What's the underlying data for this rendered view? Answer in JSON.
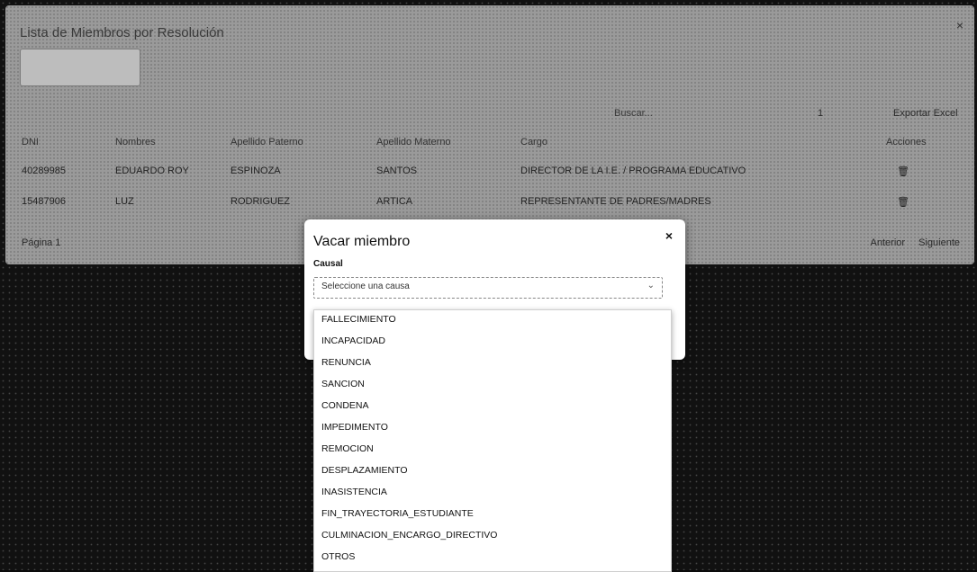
{
  "panel": {
    "title": "Lista de Miembros por Resolución",
    "close_glyph": "×",
    "search_label": "Buscar...",
    "search_count": "1",
    "export_label": "Exportar Excel",
    "columns": [
      "DNI",
      "Nombres",
      "Apellido Paterno",
      "Apellido Materno",
      "Cargo",
      "Acciones"
    ],
    "rows": [
      [
        "40289985",
        "EDUARDO ROY",
        "ESPINOZA",
        "SANTOS",
        "DIRECTOR DE LA I.E. / PROGRAMA EDUCATIVO",
        "🗑"
      ],
      [
        "15487906",
        "LUZ",
        "RODRIGUEZ",
        "ARTICA",
        "REPRESENTANTE DE PADRES/MADRES",
        "🗑"
      ]
    ],
    "pager_left": "Página 1",
    "pager_prev": "Anterior",
    "pager_next": "Siguiente"
  },
  "modal": {
    "title": "Vacar miembro",
    "close_glyph": "×",
    "field_label": "Causal",
    "select_placeholder": "Seleccione una causa",
    "select_arrow": "⌄"
  },
  "dropdown": {
    "options": [
      "FALLECIMIENTO",
      "INCAPACIDAD",
      "RENUNCIA",
      "SANCION",
      "CONDENA",
      "IMPEDIMENTO",
      "REMOCION",
      "DESPLAZAMIENTO",
      "INASISTENCIA",
      "FIN_TRAYECTORIA_ESTUDIANTE",
      "CULMINACION_ENCARGO_DIRECTIVO",
      "OTROS"
    ]
  }
}
